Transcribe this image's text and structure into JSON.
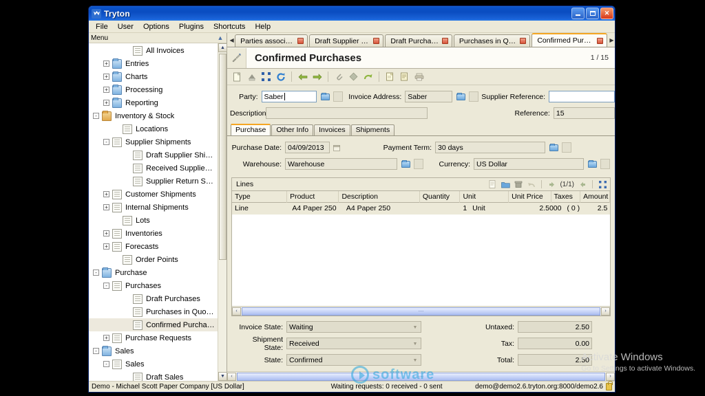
{
  "window": {
    "title": "Tryton",
    "app_icon": "tryton-logo-icon",
    "minimize": "_",
    "maximize": "□",
    "close": "✕"
  },
  "menubar": {
    "items": [
      "File",
      "User",
      "Options",
      "Plugins",
      "Shortcuts",
      "Help"
    ]
  },
  "sidebar": {
    "header": "Menu",
    "items": [
      {
        "label": "All Invoices",
        "indent": 3,
        "expander": "",
        "icon": "document-icon",
        "selected": false
      },
      {
        "label": "Entries",
        "indent": 1,
        "expander": "+",
        "icon": "folder-icon",
        "selected": false
      },
      {
        "label": "Charts",
        "indent": 1,
        "expander": "+",
        "icon": "folder-icon",
        "selected": false
      },
      {
        "label": "Processing",
        "indent": 1,
        "expander": "+",
        "icon": "folder-icon",
        "selected": false
      },
      {
        "label": "Reporting",
        "indent": 1,
        "expander": "+",
        "icon": "folder-icon",
        "selected": false
      },
      {
        "label": "Inventory & Stock",
        "indent": 0,
        "expander": "-",
        "icon": "folder-open-icon",
        "selected": false
      },
      {
        "label": "Locations",
        "indent": 2,
        "expander": "",
        "icon": "document-icon",
        "selected": false
      },
      {
        "label": "Supplier Shipments",
        "indent": 1,
        "expander": "-",
        "icon": "document-icon",
        "selected": false
      },
      {
        "label": "Draft Supplier Shipment",
        "indent": 3,
        "expander": "",
        "icon": "document-icon",
        "selected": false
      },
      {
        "label": "Received Supplier shipments",
        "indent": 3,
        "expander": "",
        "icon": "document-icon",
        "selected": false
      },
      {
        "label": "Supplier Return Shipments",
        "indent": 3,
        "expander": "",
        "icon": "document-icon",
        "selected": false
      },
      {
        "label": "Customer Shipments",
        "indent": 1,
        "expander": "+",
        "icon": "document-icon",
        "selected": false
      },
      {
        "label": "Internal Shipments",
        "indent": 1,
        "expander": "+",
        "icon": "document-icon",
        "selected": false
      },
      {
        "label": "Lots",
        "indent": 2,
        "expander": "",
        "icon": "document-icon",
        "selected": false
      },
      {
        "label": "Inventories",
        "indent": 1,
        "expander": "+",
        "icon": "document-icon",
        "selected": false
      },
      {
        "label": "Forecasts",
        "indent": 1,
        "expander": "+",
        "icon": "document-icon",
        "selected": false
      },
      {
        "label": "Order Points",
        "indent": 2,
        "expander": "",
        "icon": "document-icon",
        "selected": false
      },
      {
        "label": "Purchase",
        "indent": 0,
        "expander": "-",
        "icon": "folder-icon",
        "selected": false
      },
      {
        "label": "Purchases",
        "indent": 1,
        "expander": "-",
        "icon": "document-icon",
        "selected": false
      },
      {
        "label": "Draft Purchases",
        "indent": 3,
        "expander": "",
        "icon": "document-icon",
        "selected": false
      },
      {
        "label": "Purchases in Quotation",
        "indent": 3,
        "expander": "",
        "icon": "document-icon",
        "selected": false
      },
      {
        "label": "Confirmed Purchases",
        "indent": 3,
        "expander": "",
        "icon": "document-icon",
        "selected": true
      },
      {
        "label": "Purchase Requests",
        "indent": 1,
        "expander": "+",
        "icon": "document-icon",
        "selected": false
      },
      {
        "label": "Sales",
        "indent": 0,
        "expander": "-",
        "icon": "folder-icon",
        "selected": false
      },
      {
        "label": "Sales",
        "indent": 1,
        "expander": "-",
        "icon": "document-icon",
        "selected": false
      },
      {
        "label": "Draft Sales",
        "indent": 3,
        "expander": "",
        "icon": "document-icon",
        "selected": false
      }
    ]
  },
  "tabs": {
    "prev_arrow": "◀",
    "next_arrow": "▶",
    "items": [
      {
        "label": "Parties associated ...",
        "active": false,
        "close": "×"
      },
      {
        "label": "Draft Supplier Ship ...",
        "active": false,
        "close": "×"
      },
      {
        "label": "Draft Purchases     ...",
        "active": false,
        "close": "×"
      },
      {
        "label": "Purchases in Quota ...",
        "active": false,
        "close": "×"
      },
      {
        "label": "Confirmed Purchas ...",
        "active": true,
        "close": "×"
      }
    ]
  },
  "form_header": {
    "icon": "form-tools-icon",
    "title": "Confirmed Purchases",
    "record_counter": "1 / 15"
  },
  "toolbar": {
    "buttons": [
      {
        "name": "new-icon",
        "glyph": "📄"
      },
      {
        "name": "save-icon",
        "glyph": "💾"
      },
      {
        "name": "switch-view-icon",
        "glyph": "⛶"
      },
      {
        "name": "reload-icon",
        "glyph": "⟳"
      },
      {
        "name": "previous-record-icon",
        "glyph": "◀"
      },
      {
        "name": "next-record-icon",
        "glyph": "▶"
      },
      {
        "name": "attachment-icon",
        "glyph": "📎"
      },
      {
        "name": "action-icon",
        "glyph": "◆"
      },
      {
        "name": "relate-icon",
        "glyph": "↷"
      },
      {
        "name": "report-icon",
        "glyph": "🗒"
      },
      {
        "name": "email-icon",
        "glyph": "📑"
      },
      {
        "name": "print-icon",
        "glyph": "🖨"
      }
    ]
  },
  "form": {
    "party": {
      "label": "Party:",
      "value": "Saber"
    },
    "invoice_address": {
      "label": "Invoice Address:",
      "value": "Saber"
    },
    "supplier_reference": {
      "label": "Supplier Reference:",
      "value": ""
    },
    "description": {
      "label": "Description:",
      "value": ""
    },
    "reference": {
      "label": "Reference:",
      "value": "15"
    },
    "inner_tabs": [
      {
        "label": "Purchase",
        "active": true
      },
      {
        "label": "Other Info",
        "active": false
      },
      {
        "label": "Invoices",
        "active": false
      },
      {
        "label": "Shipments",
        "active": false
      }
    ],
    "purchase_date": {
      "label": "Purchase Date:",
      "value": "04/09/2013"
    },
    "payment_term": {
      "label": "Payment Term:",
      "value": "30 days"
    },
    "warehouse": {
      "label": "Warehouse:",
      "value": "Warehouse"
    },
    "currency": {
      "label": "Currency:",
      "value": "US Dollar"
    }
  },
  "lines": {
    "title": "Lines",
    "pager": "(1/1)",
    "prev_arrow": "◀",
    "next_arrow": "▶",
    "tools": [
      {
        "name": "line-new-icon",
        "glyph": "▤"
      },
      {
        "name": "line-open-icon",
        "glyph": "📂"
      },
      {
        "name": "line-delete-icon",
        "glyph": "🗑"
      },
      {
        "name": "line-undo-icon",
        "glyph": "↶"
      }
    ],
    "fullscreen_icon": "⛶",
    "columns": [
      "Type",
      "Product",
      "Description",
      "Quantity",
      "Unit",
      "Unit Price",
      "Taxes",
      "Amount"
    ],
    "rows": [
      {
        "Type": "Line",
        "Product": "A4 Paper 250",
        "Description": "A4 Paper 250",
        "Quantity": "1",
        "Unit": "Unit",
        "Unit Price": "2.5000",
        "Taxes": "( 0 )",
        "Amount": "2.5"
      }
    ],
    "scroll_left": "‹",
    "scroll_right": "›"
  },
  "states": {
    "invoice_state": {
      "label": "Invoice State:",
      "value": "Waiting"
    },
    "shipment_state": {
      "label": "Shipment State:",
      "value": "Received"
    },
    "state": {
      "label": "State:",
      "value": "Confirmed"
    },
    "untaxed": {
      "label": "Untaxed:",
      "value": "2.50"
    },
    "tax": {
      "label": "Tax:",
      "value": "0.00"
    },
    "total": {
      "label": "Total:",
      "value": "2.50"
    }
  },
  "statusbar": {
    "company": "Demo - Michael Scott Paper Company [US Dollar]",
    "requests": "Waiting requests: 0 received - 0 sent",
    "server": "demo@demo2.6.tryton.org:8000/demo2.6",
    "lock_icon": "lock-icon"
  },
  "watermarks": {
    "activate_title": "Activate Windows",
    "activate_sub": "Go to Settings to activate Windows.",
    "software_text": "software"
  },
  "colors": {
    "title_blue": "#0a52c8",
    "window_bg": "#ece9d8",
    "tab_accent": "#f5a623",
    "selection": "#ede9dd",
    "watermark_blue": "#2aa6dd"
  }
}
